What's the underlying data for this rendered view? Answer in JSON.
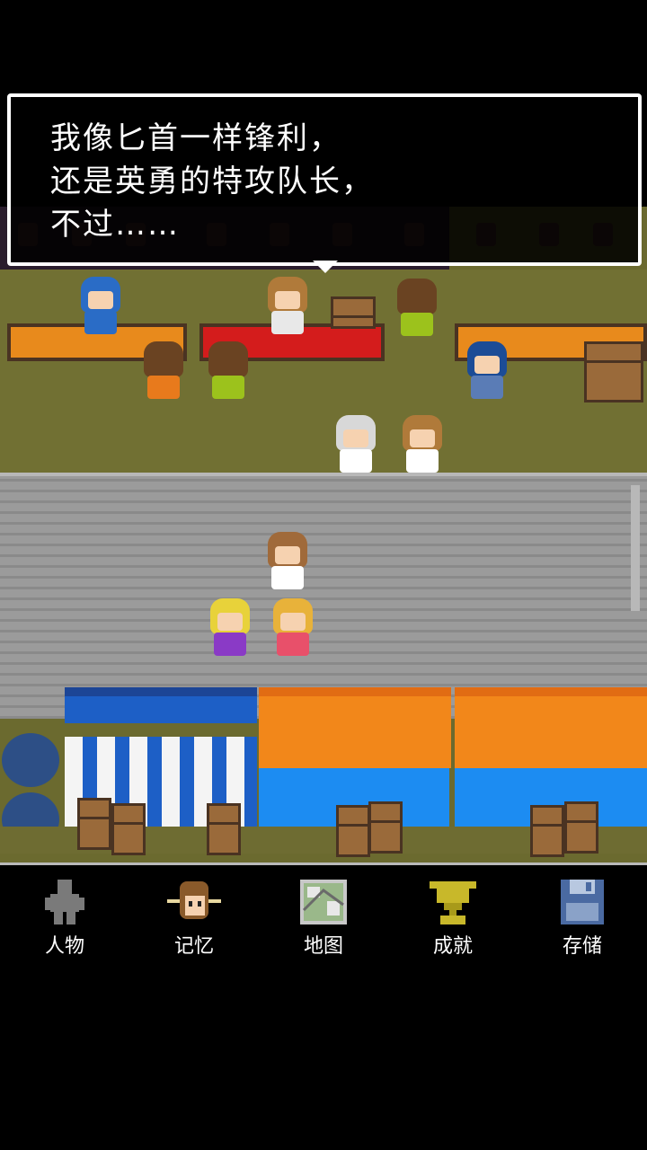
{
  "dialog": {
    "lines": [
      "我像匕首一样锋利，",
      "还是英勇的特攻队长，",
      "不过……"
    ]
  },
  "menu": {
    "items": [
      {
        "label": "人物",
        "icon": "person-silhouette-icon"
      },
      {
        "label": "记忆",
        "icon": "memory-face-icon"
      },
      {
        "label": "地图",
        "icon": "map-icon"
      },
      {
        "label": "成就",
        "icon": "trophy-icon"
      },
      {
        "label": "存储",
        "icon": "floppy-disk-icon"
      }
    ]
  },
  "colors": {
    "menu_text": "#ffffff",
    "dialog_border": "#ffffff",
    "road": "#9b9b9b",
    "grass": "#717033",
    "awning_orange": "#f2871a",
    "awning_blue": "#1d5fc6"
  }
}
